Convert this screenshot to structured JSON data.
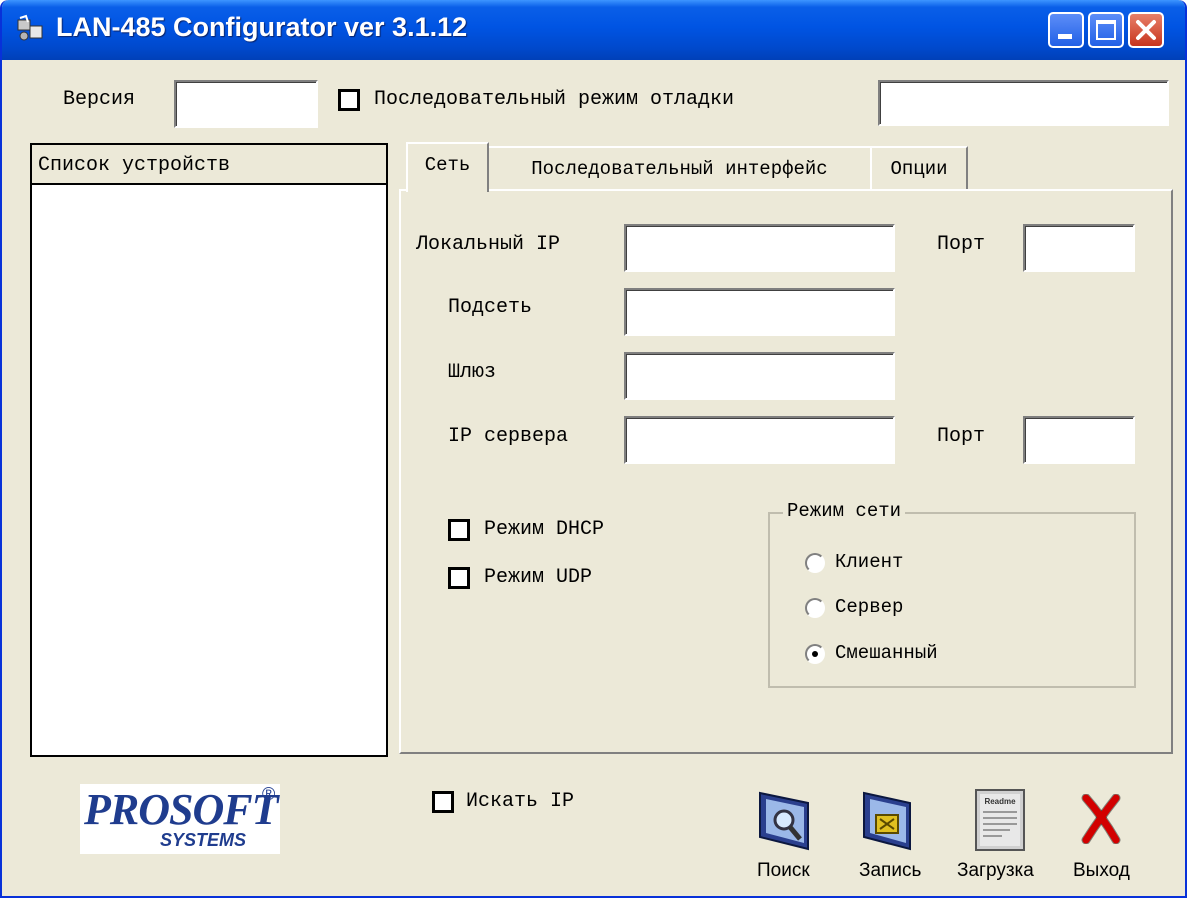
{
  "window": {
    "title": "LAN-485 Configurator ver 3.1.12",
    "controls": [
      "minimize",
      "maximize",
      "close"
    ]
  },
  "top": {
    "version_label": "Версия",
    "version_value": "",
    "debug_checkbox_label": "Последовательный режим отладки",
    "debug_checked": false,
    "debug_value": ""
  },
  "devices": {
    "header": "Список устройств",
    "items": []
  },
  "tabs": [
    {
      "label": "Сеть",
      "active": true
    },
    {
      "label": "Последовательный интерфейс",
      "active": false
    },
    {
      "label": "Опции",
      "active": false
    }
  ],
  "network": {
    "local_ip_label": "Локальный IP",
    "local_ip_value": "",
    "port_label": "Порт",
    "local_port_value": "",
    "subnet_label": "Подсеть",
    "subnet_value": "",
    "gateway_label": "Шлюз",
    "gateway_value": "",
    "server_ip_label": "IP сервера",
    "server_ip_value": "",
    "server_port_label": "Порт",
    "server_port_value": "",
    "dhcp_label": "Режим DHCP",
    "dhcp_checked": false,
    "udp_label": "Режим UDP",
    "udp_checked": false,
    "mode_group_title": "Режим сети",
    "modes": [
      {
        "label": "Клиент",
        "selected": false
      },
      {
        "label": "Сервер",
        "selected": false
      },
      {
        "label": "Смешанный",
        "selected": true
      }
    ]
  },
  "bottom": {
    "logo_main": "PROSOFT",
    "logo_reg": "®",
    "logo_sub": "SYSTEMS",
    "search_ip_label": "Искать IP",
    "search_ip_checked": false,
    "buttons": [
      {
        "label": "Поиск",
        "icon": "search-monitor-icon"
      },
      {
        "label": "Запись",
        "icon": "write-monitor-icon"
      },
      {
        "label": "Загрузка",
        "icon": "readme-document-icon"
      },
      {
        "label": "Выход",
        "icon": "red-x-icon"
      }
    ],
    "readme_text": "Readme"
  },
  "colors": {
    "titlebar": "#0054e3",
    "window_bg": "#ece9d8",
    "logo_blue": "#1f3c8e",
    "exit_red": "#d20000"
  }
}
